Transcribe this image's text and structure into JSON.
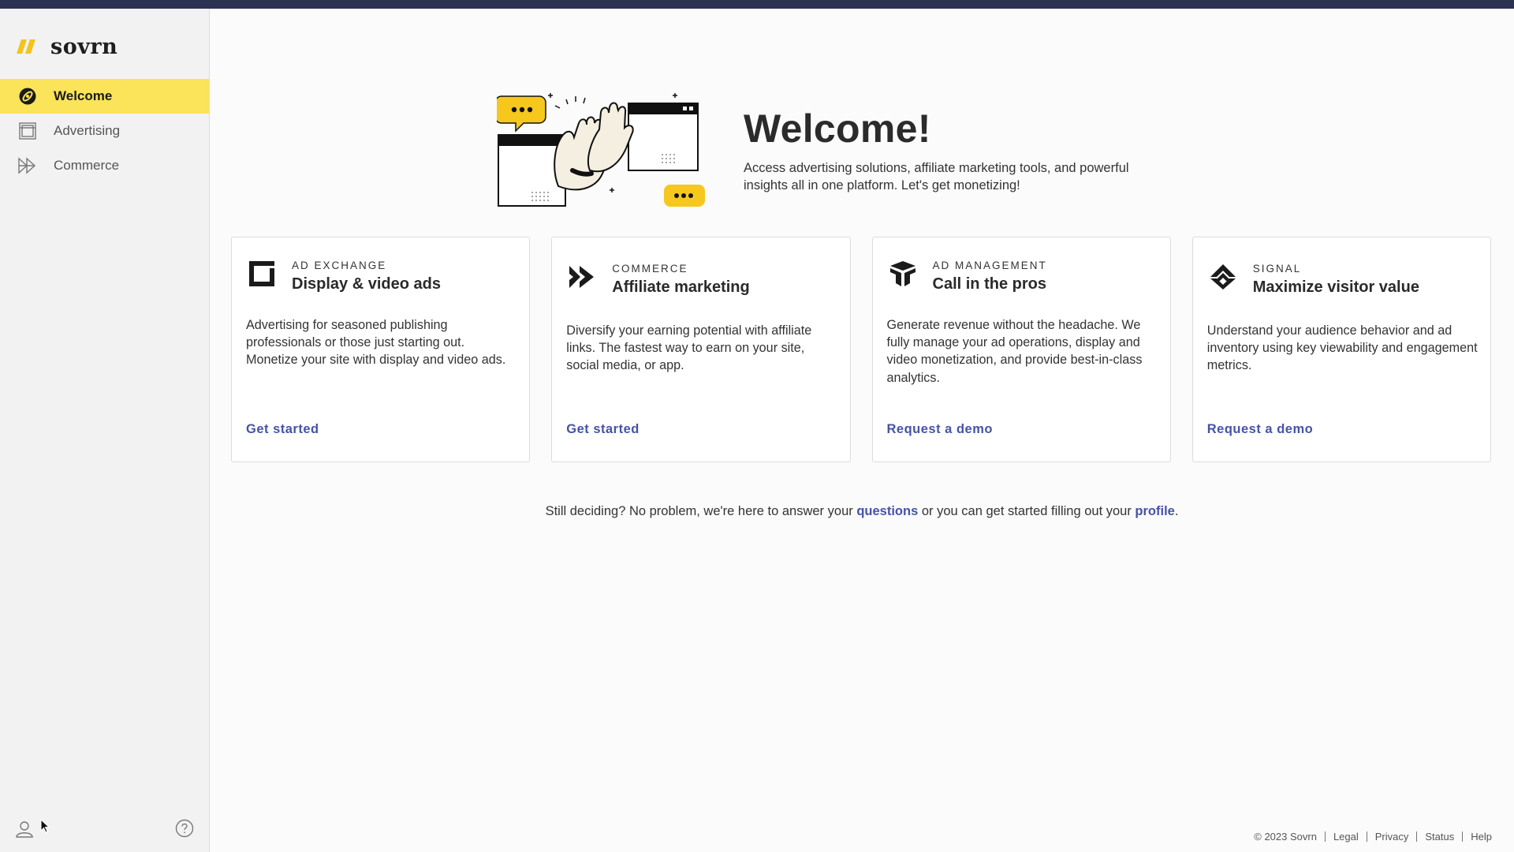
{
  "brand": {
    "name": "sovrn",
    "accent": "#f2c41c"
  },
  "sidebar": {
    "items": [
      {
        "label": "Welcome",
        "icon": "compass-icon",
        "active": true
      },
      {
        "label": "Advertising",
        "icon": "layout-icon",
        "active": false
      },
      {
        "label": "Commerce",
        "icon": "fast-forward-icon",
        "active": false
      }
    ],
    "user_icon": "user-icon",
    "help_icon": "help-circle-icon"
  },
  "hero": {
    "title": "Welcome!",
    "subtitle": "Access advertising solutions, affiliate marketing tools, and powerful insights all in one platform. Let's get monetizing!",
    "illustration": "high-five-illustration"
  },
  "cards": [
    {
      "kicker": "AD EXCHANGE",
      "title": "Display & video ads",
      "description": "Advertising for seasoned publishing professionals or those just starting out. Monetize your site with display and video ads.",
      "link": "Get started",
      "icon": "ad-exchange-icon"
    },
    {
      "kicker": "COMMERCE",
      "title": "Affiliate marketing",
      "description": "Diversify your earning potential with affiliate links. The fastest way to earn on your site, social media, or app.",
      "link": "Get started",
      "icon": "commerce-arrows-icon"
    },
    {
      "kicker": "AD MANAGEMENT",
      "title": "Call in the pros",
      "description": "Generate revenue without the headache. We fully manage your ad operations, display and video monetization, and provide best-in-class analytics.",
      "link": "Request a demo",
      "icon": "ad-management-icon"
    },
    {
      "kicker": "SIGNAL",
      "title": "Maximize visitor value",
      "description": "Understand your audience behavior and ad inventory using key viewability and engagement metrics.",
      "link": "Request a demo",
      "icon": "signal-icon"
    }
  ],
  "decide": {
    "prefix": "Still deciding? No problem, we're here to answer your ",
    "questions_link": "questions",
    "middle": " or you can get started filling out your ",
    "profile_link": "profile",
    "suffix": "."
  },
  "footer": {
    "copyright": "© 2023 Sovrn",
    "links": [
      "Legal",
      "Privacy",
      "Status",
      "Help"
    ]
  },
  "colors": {
    "link": "#4553a8",
    "active_nav": "#fbe35a",
    "top_bar": "#2b3252"
  }
}
